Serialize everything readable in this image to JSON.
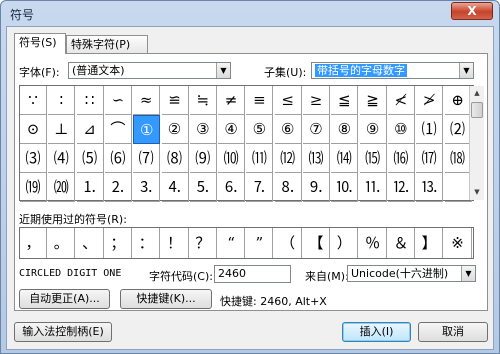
{
  "window": {
    "title": "符号",
    "close_label": "X"
  },
  "tabs": [
    {
      "label": "符号(S)"
    },
    {
      "label": "特殊字符(P)"
    }
  ],
  "font": {
    "label": "字体(F):",
    "value": "(普通文本)"
  },
  "subset": {
    "label": "子集(U):",
    "value": "带括号的字母数字"
  },
  "symbol_grid": {
    "rows": [
      [
        "∵",
        "∶",
        "∷",
        "∽",
        "≈",
        "≌",
        "≒",
        "≠",
        "≡",
        "≤",
        "≥",
        "≦",
        "≧",
        "≮",
        "≯",
        "⊕"
      ],
      [
        "⊙",
        "⊥",
        "⊿",
        "⌒",
        "①",
        "②",
        "③",
        "④",
        "⑤",
        "⑥",
        "⑦",
        "⑧",
        "⑨",
        "⑩",
        "⑴",
        "⑵"
      ],
      [
        "⑶",
        "⑷",
        "⑸",
        "⑹",
        "⑺",
        "⑻",
        "⑼",
        "⑽",
        "⑾",
        "⑿",
        "⒀",
        "⒁",
        "⒂",
        "⒃",
        "⒄",
        "⒅"
      ],
      [
        "⒆",
        "⒇",
        "⒈",
        "⒉",
        "⒊",
        "⒋",
        "⒌",
        "⒍",
        "⒎",
        "⒏",
        "⒐",
        "⒑",
        "⒒",
        "⒓",
        "⒔",
        ""
      ]
    ],
    "selected": "①"
  },
  "recent": {
    "label": "近期使用过的符号(R):",
    "symbols": [
      "，",
      "。",
      "、",
      "；",
      "：",
      "！",
      "？",
      "“",
      "”",
      "（",
      "【",
      "）",
      "％",
      "＆",
      "】",
      "※"
    ]
  },
  "char_info": {
    "name": "CIRCLED DIGIT ONE",
    "code_label": "字符代码(C):",
    "code_value": "2460",
    "from_label": "来自(M):",
    "from_value": "Unicode(十六进制)"
  },
  "buttons": {
    "autocorrect": "自动更正(A)...",
    "shortcut_key": "快捷键(K)...",
    "shortcut_text": "快捷键: 2460, Alt+X",
    "ime_control": "输入法控制柄(E)",
    "insert": "插入(I)",
    "cancel": "取消"
  }
}
